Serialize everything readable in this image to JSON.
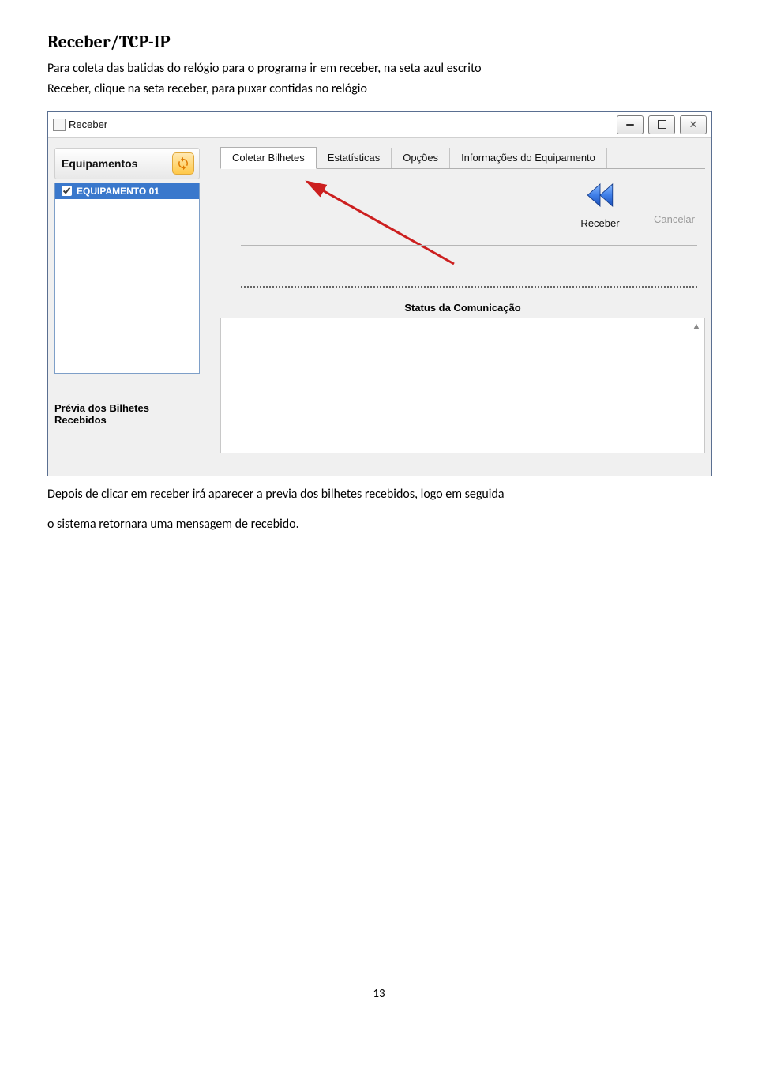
{
  "doc": {
    "heading": "Receber/TCP-IP",
    "p1": "Para coleta das batidas do relógio para o programa ir em receber,  na  seta azul escrito",
    "p2": "Receber, clique na seta receber, para   puxar contidas no relógio",
    "after1": "Depois de clicar em receber irá aparecer a previa dos bilhetes recebidos, logo em seguida",
    "after2": "o sistema retornara uma mensagem de recebido.",
    "page_number": "13"
  },
  "window": {
    "title": "Receber",
    "equipamentos_label": "Equipamentos",
    "equip_item": "EQUIPAMENTO 01",
    "previa_label": "Prévia dos Bilhetes Recebidos",
    "tabs": {
      "coletar": "Coletar Bilhetes",
      "estatisticas": "Estatísticas",
      "opcoes": "Opções",
      "info": "Informações do Equipamento"
    },
    "receber_label_pre": "R",
    "receber_label_post": "eceber",
    "cancelar_label_pre": "Cancela",
    "cancelar_label_post": "r",
    "status_label": "Status da Comunicação"
  }
}
